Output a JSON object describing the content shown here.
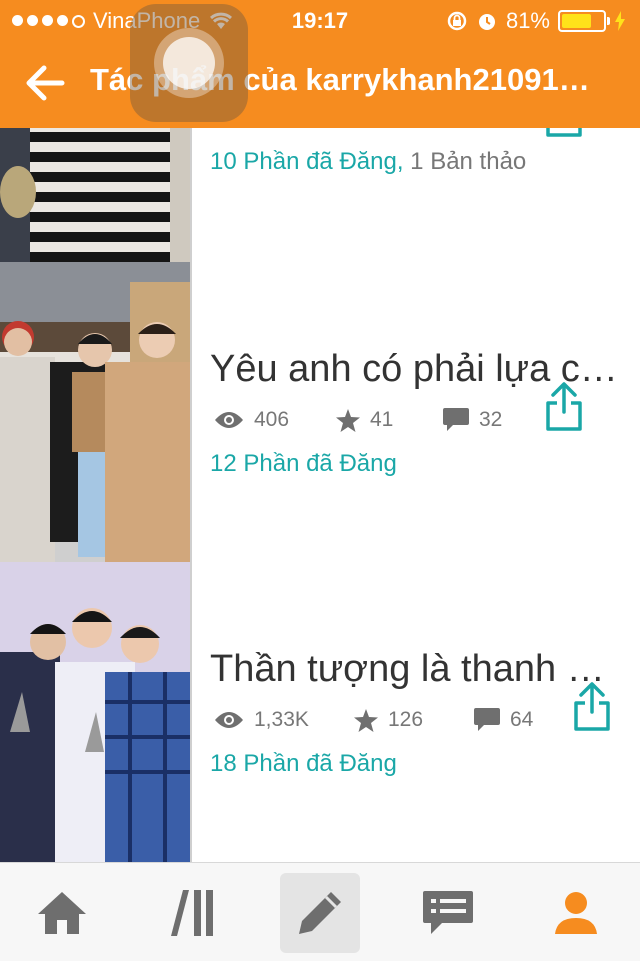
{
  "status_bar": {
    "carrier": "VinaPhone",
    "time": "19:17",
    "battery": "81%",
    "battery_level": 0.81,
    "signal_bars_filled": 4,
    "signal_bars_total": 5
  },
  "header": {
    "title": "Tác phẩm của karrykhanh21091…",
    "background": "#f68c1f"
  },
  "stories": [
    {
      "title": "",
      "parts_published": "10 Phần đã Đăng,",
      "parts_draft": "1 Bản thảo"
    },
    {
      "title": "Yêu anh có phải lựa ch…",
      "reads": "406",
      "votes": "41",
      "comments": "32",
      "parts_published": "12 Phần đã Đăng",
      "parts_draft": ""
    },
    {
      "title": "Thần tượng là thanh m…",
      "reads": "1,33K",
      "votes": "126",
      "comments": "64",
      "parts_published": "18 Phần đã Đăng",
      "parts_draft": ""
    }
  ],
  "tabbar": {
    "items": [
      "home-icon",
      "library-icon",
      "write-icon",
      "messages-icon",
      "profile-icon"
    ],
    "active": "write-icon",
    "active_color": "#f68c1f"
  },
  "colors": {
    "accent_teal": "#1aa7a7"
  }
}
